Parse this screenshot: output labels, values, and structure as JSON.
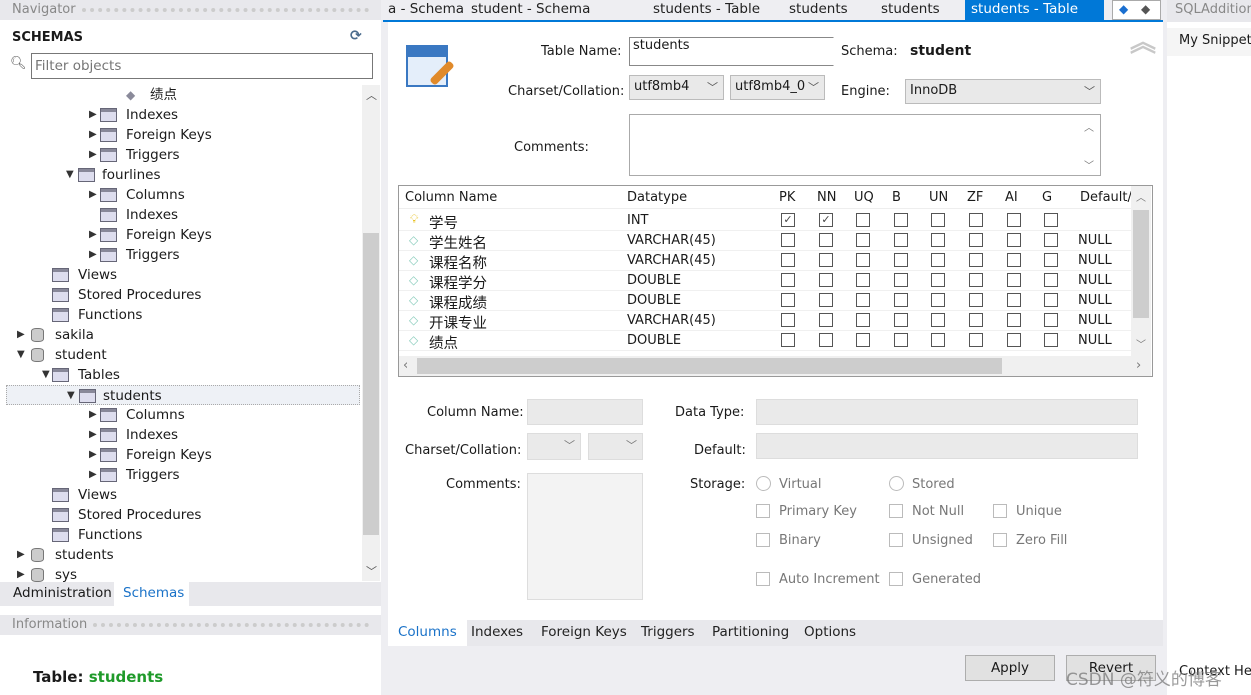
{
  "navigator": {
    "title": "Navigator",
    "schemas_label": "SCHEMAS",
    "filter_placeholder": "Filter objects",
    "tree": [
      {
        "label": "绩点",
        "depth": 5,
        "kind": "column",
        "expanded": null
      },
      {
        "label": "Indexes",
        "depth": 4,
        "kind": "folder",
        "expanded": false
      },
      {
        "label": "Foreign Keys",
        "depth": 4,
        "kind": "folder",
        "expanded": false
      },
      {
        "label": "Triggers",
        "depth": 4,
        "kind": "folder",
        "expanded": false
      },
      {
        "label": "fourlines",
        "depth": 3,
        "kind": "table",
        "expanded": true
      },
      {
        "label": "Columns",
        "depth": 4,
        "kind": "folder",
        "expanded": false
      },
      {
        "label": "Indexes",
        "depth": 4,
        "kind": "folder",
        "expanded": null
      },
      {
        "label": "Foreign Keys",
        "depth": 4,
        "kind": "folder",
        "expanded": false
      },
      {
        "label": "Triggers",
        "depth": 4,
        "kind": "folder",
        "expanded": false
      },
      {
        "label": "Views",
        "depth": 2,
        "kind": "folder",
        "expanded": null
      },
      {
        "label": "Stored Procedures",
        "depth": 2,
        "kind": "folder",
        "expanded": null
      },
      {
        "label": "Functions",
        "depth": 2,
        "kind": "folder",
        "expanded": null
      },
      {
        "label": "sakila",
        "depth": 0,
        "kind": "schema",
        "expanded": false
      },
      {
        "label": "student",
        "depth": 0,
        "kind": "schema",
        "expanded": true
      },
      {
        "label": "Tables",
        "depth": 1,
        "kind": "folder",
        "expanded": true
      },
      {
        "label": "students",
        "depth": 3,
        "kind": "table",
        "expanded": true,
        "selected": true
      },
      {
        "label": "Columns",
        "depth": 4,
        "kind": "folder",
        "expanded": false
      },
      {
        "label": "Indexes",
        "depth": 4,
        "kind": "folder",
        "expanded": false
      },
      {
        "label": "Foreign Keys",
        "depth": 4,
        "kind": "folder",
        "expanded": false
      },
      {
        "label": "Triggers",
        "depth": 4,
        "kind": "folder",
        "expanded": false
      },
      {
        "label": "Views",
        "depth": 2,
        "kind": "folder",
        "expanded": null
      },
      {
        "label": "Stored Procedures",
        "depth": 2,
        "kind": "folder",
        "expanded": null
      },
      {
        "label": "Functions",
        "depth": 2,
        "kind": "folder",
        "expanded": null
      },
      {
        "label": "students",
        "depth": 0,
        "kind": "schema",
        "expanded": false
      },
      {
        "label": "sys",
        "depth": 0,
        "kind": "schema",
        "expanded": false
      }
    ],
    "bottom_tabs": [
      "Administration",
      "Schemas"
    ],
    "active_bottom_tab": "Schemas",
    "info_title": "Information",
    "info_label": "Table:",
    "info_value": "students"
  },
  "tabs": [
    "a - Schema",
    "student - Schema",
    "students - Table",
    "students",
    "students",
    "students - Table"
  ],
  "active_tab": 5,
  "right_panel": {
    "title": "SQLAdditions",
    "snippets": "My Snippets",
    "context_help": "Context Help"
  },
  "editor": {
    "table_name_label": "Table Name:",
    "table_name": "students",
    "schema_label": "Schema:",
    "schema": "student",
    "charset_label": "Charset/Collation:",
    "charset": "utf8mb4",
    "collation": "utf8mb4_0",
    "engine_label": "Engine:",
    "engine": "InnoDB",
    "comments_label": "Comments:"
  },
  "grid": {
    "headers": [
      "Column Name",
      "Datatype",
      "PK",
      "NN",
      "UQ",
      "B",
      "UN",
      "ZF",
      "AI",
      "G",
      "Default/"
    ],
    "rows": [
      {
        "name": "学号",
        "type": "INT",
        "flags": [
          1,
          1,
          0,
          0,
          0,
          0,
          0,
          0
        ],
        "default": "",
        "pk": true
      },
      {
        "name": "学生姓名",
        "type": "VARCHAR(45)",
        "flags": [
          0,
          0,
          0,
          0,
          0,
          0,
          0,
          0
        ],
        "default": "NULL"
      },
      {
        "name": "课程名称",
        "type": "VARCHAR(45)",
        "flags": [
          0,
          0,
          0,
          0,
          0,
          0,
          0,
          0
        ],
        "default": "NULL"
      },
      {
        "name": "课程学分",
        "type": "DOUBLE",
        "flags": [
          0,
          0,
          0,
          0,
          0,
          0,
          0,
          0
        ],
        "default": "NULL"
      },
      {
        "name": "课程成绩",
        "type": "DOUBLE",
        "flags": [
          0,
          0,
          0,
          0,
          0,
          0,
          0,
          0
        ],
        "default": "NULL"
      },
      {
        "name": "开课专业",
        "type": "VARCHAR(45)",
        "flags": [
          0,
          0,
          0,
          0,
          0,
          0,
          0,
          0
        ],
        "default": "NULL"
      },
      {
        "name": "绩点",
        "type": "DOUBLE",
        "flags": [
          0,
          0,
          0,
          0,
          0,
          0,
          0,
          0
        ],
        "default": "NULL"
      }
    ]
  },
  "details": {
    "column_name_label": "Column Name:",
    "charset_label": "Charset/Collation:",
    "comments_label": "Comments:",
    "data_type_label": "Data Type:",
    "default_label": "Default:",
    "storage_label": "Storage:",
    "virtual": "Virtual",
    "stored": "Stored",
    "primary_key": "Primary Key",
    "not_null": "Not Null",
    "unique": "Unique",
    "binary": "Binary",
    "unsigned": "Unsigned",
    "zero_fill": "Zero Fill",
    "auto_increment": "Auto Increment",
    "generated": "Generated"
  },
  "editor_tabs": [
    "Columns",
    "Indexes",
    "Foreign Keys",
    "Triggers",
    "Partitioning",
    "Options"
  ],
  "buttons": {
    "apply": "Apply",
    "revert": "Revert"
  },
  "watermark": "CSDN @符义的博客",
  "colors": {
    "accent": "#0078d7",
    "info_green": "#1f9a2a"
  }
}
